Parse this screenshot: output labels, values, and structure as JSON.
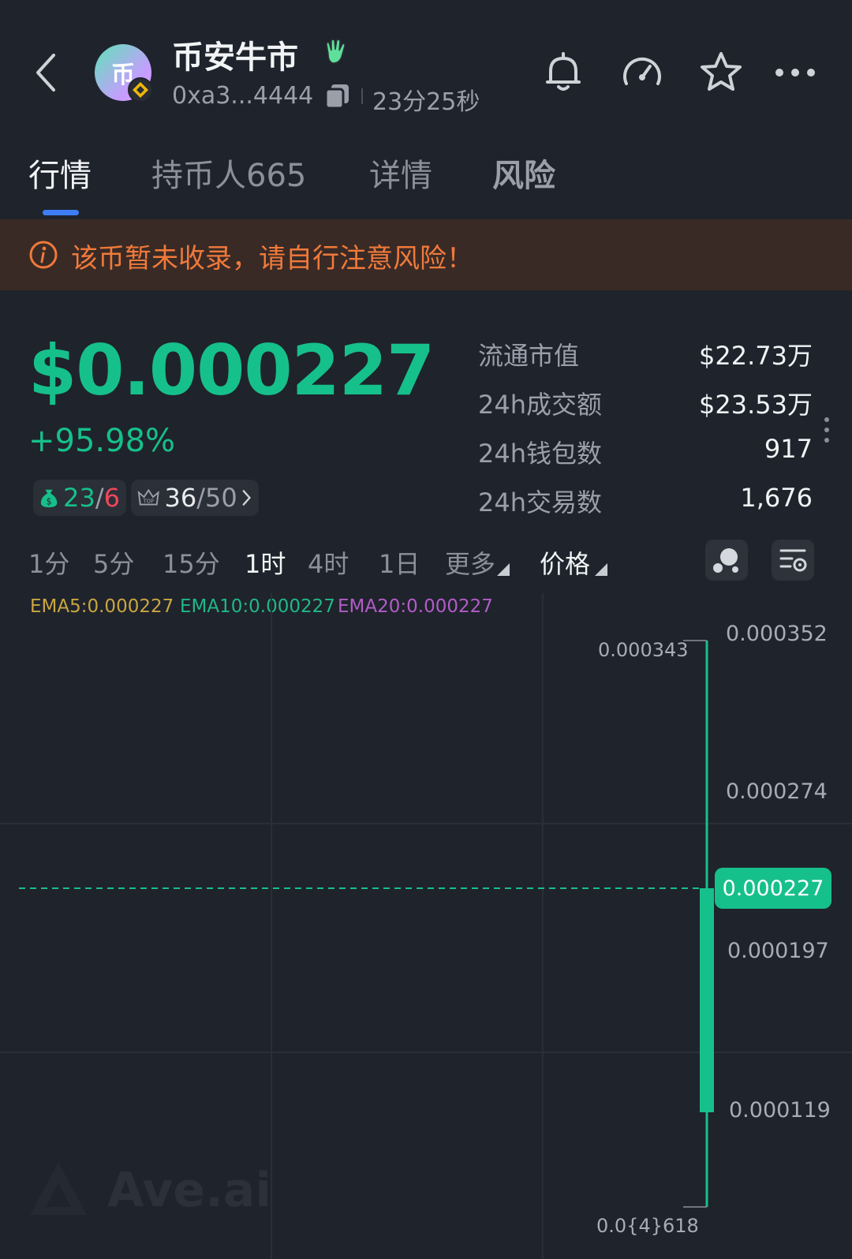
{
  "header": {
    "token_name": "币安牛市",
    "avatar_char": "币",
    "address": "0xa3...4444",
    "age": "23分25秒"
  },
  "tabs": [
    {
      "label": "行情",
      "active": true
    },
    {
      "label": "持币人665",
      "active": false
    },
    {
      "label": "详情",
      "active": false
    },
    {
      "label": "风险",
      "active": false
    }
  ],
  "warning": {
    "text": "该币暂未收录，请自行注意风险！"
  },
  "price": {
    "value": "$0.000227",
    "change": "+95.98%",
    "chip1": {
      "a": "23",
      "sep": "/",
      "b": "6"
    },
    "chip2": {
      "a": "36",
      "b": "/50"
    }
  },
  "stats": [
    {
      "label": "流通市值",
      "value": "$22.73万"
    },
    {
      "label": "24h成交额",
      "value": "$23.53万"
    },
    {
      "label": "24h钱包数",
      "value": "917"
    },
    {
      "label": "24h交易数",
      "value": "1,676"
    }
  ],
  "intervals": [
    "1分",
    "5分",
    "15分",
    "1时",
    "4时",
    "1日",
    "更多",
    "价格"
  ],
  "active_interval": "1时",
  "ema": {
    "ema5": "EMA5:0.000227",
    "ema10": "EMA10:0.000227",
    "ema20": "EMA20:0.000227"
  },
  "colors": {
    "up": "#16c08a",
    "down": "#f0475a",
    "accent": "#3d7ef6",
    "warning": "#f07a3a",
    "ema5": "#c9a640",
    "ema10": "#1fb886",
    "ema20": "#b25cc7"
  },
  "chart": {
    "y_labels": [
      "0.000352",
      "0.000274",
      "0.000197",
      "0.000119"
    ],
    "high_label": "0.000343",
    "low_label": "0.0{4}618",
    "current": "0.000227"
  },
  "watermark": "Ave.ai"
}
